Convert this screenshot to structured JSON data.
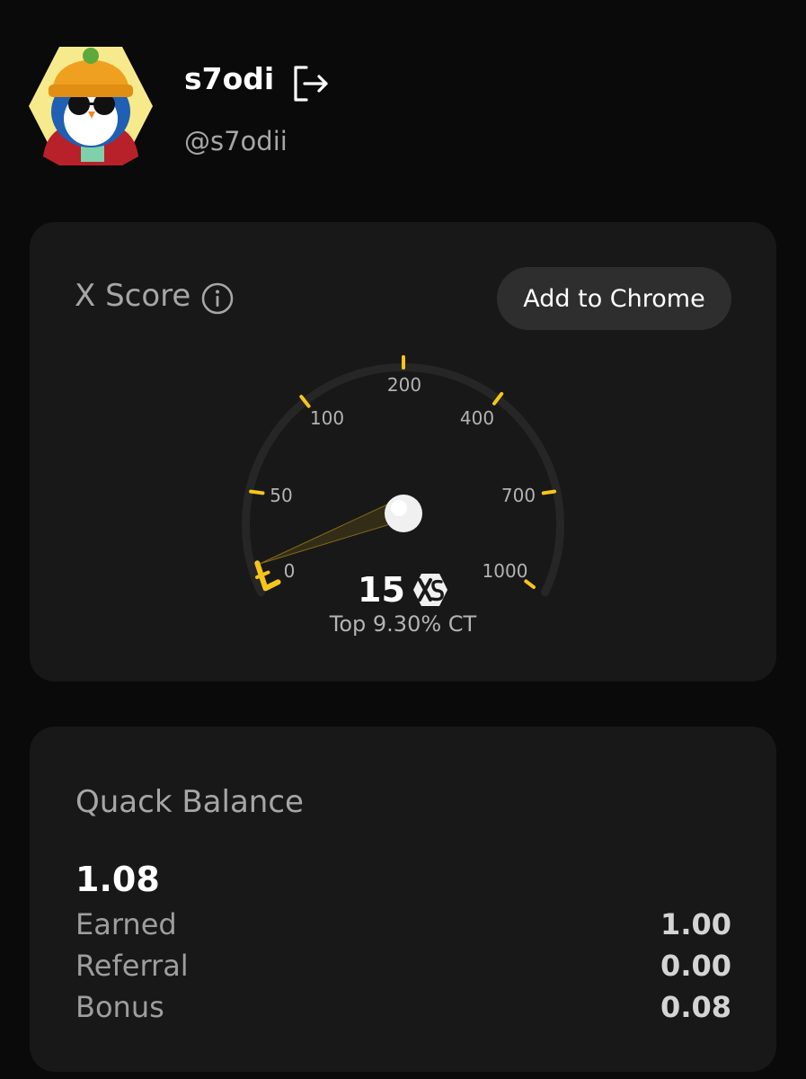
{
  "profile": {
    "username": "s7odi",
    "handle": "@s7odii"
  },
  "icons": {
    "avatar": "penguin-avatar",
    "logout": "logout-icon",
    "info": "info-icon",
    "xs_logo": "xs-logo-icon"
  },
  "score_card": {
    "title": "X Score",
    "add_to_chrome_label": "Add to Chrome",
    "score": "15",
    "rank": "Top 9.30% CT",
    "gauge_ticks": [
      "0",
      "50",
      "100",
      "200",
      "400",
      "700",
      "1000"
    ],
    "accent_color": "#f5c518"
  },
  "balance_card": {
    "title": "Quack Balance",
    "total": "1.08",
    "rows": [
      {
        "label": "Earned",
        "value": "1.00"
      },
      {
        "label": "Referral",
        "value": "0.00"
      },
      {
        "label": "Bonus",
        "value": "0.08"
      }
    ]
  }
}
